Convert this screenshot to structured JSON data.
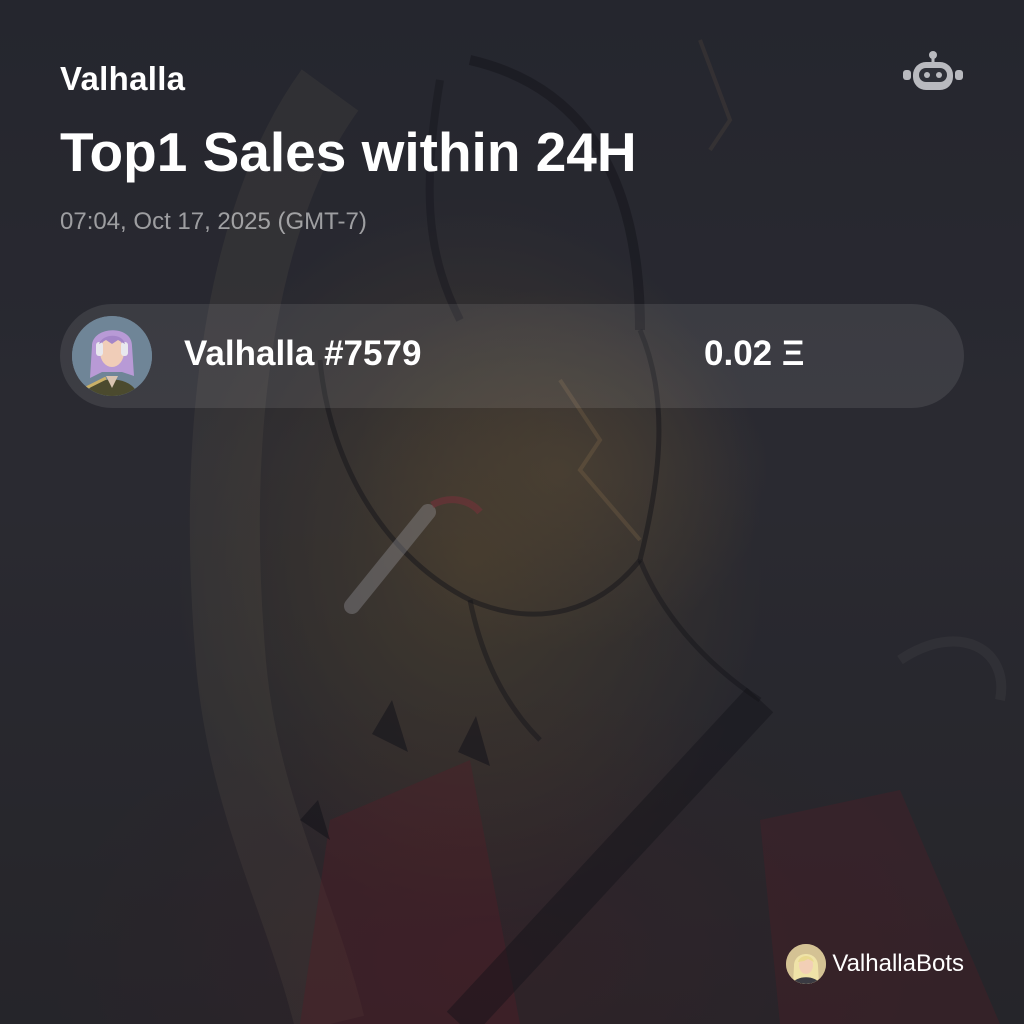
{
  "header": {
    "collection_name": "Valhalla",
    "headline": "Top1 Sales within 24H",
    "timestamp": "07:04, Oct 17, 2025 (GMT-7)",
    "bot_icon": "robot-icon"
  },
  "sales": [
    {
      "rank": 1,
      "name": "Valhalla #7579",
      "price": "0.02 Ξ",
      "thumbnail": "nft-avatar-image"
    }
  ],
  "footer": {
    "bot_name": "ValhallaBots",
    "avatar": "bot-avatar-image"
  },
  "colors": {
    "background": "#2a2b31",
    "card": "rgba(255,255,255,0.09)",
    "text_primary": "#ffffff",
    "text_muted": "rgba(255,255,255,0.55)"
  }
}
